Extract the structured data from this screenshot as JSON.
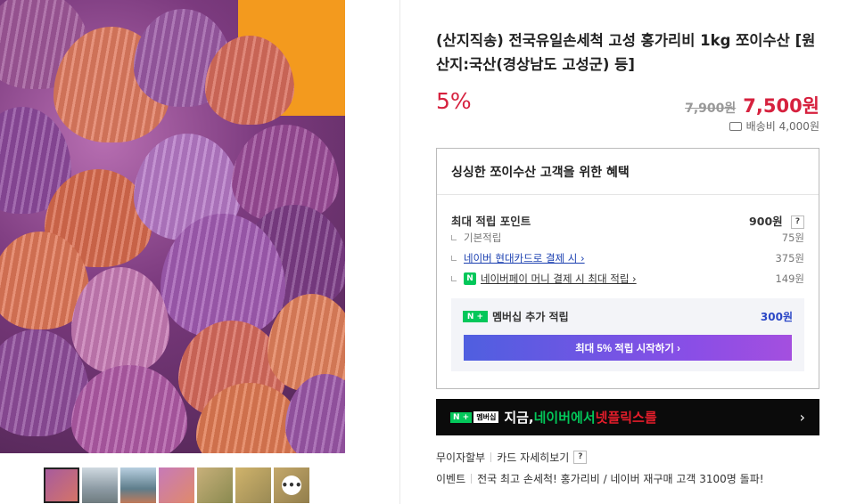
{
  "product": {
    "title": "(산지직송) 전국유일손세척 고성 홍가리비 1kg 쪼이수산 [원산지:국산(경상남도 고성군) 등]",
    "discount": "5%",
    "original_price": "7,900원",
    "sale_price": "7,500원",
    "shipping": "배송비 4,000원"
  },
  "benefit": {
    "heading": "싱싱한 쪼이수산 고객을 위한 혜택",
    "max_points_label": "최대 적립 포인트",
    "max_points_value": "900원",
    "help": "?",
    "items": [
      {
        "label": "기본적립",
        "value": "75원"
      },
      {
        "label": "네이버 현대카드로 결제 시 ›",
        "value": "375원"
      },
      {
        "label": "네이버페이 머니 결제 시 최대 적립 ›",
        "value": "149원"
      }
    ],
    "npay_badge": "N",
    "membership_badge": "N +",
    "membership_label": "멤버십 추가 적립",
    "membership_value": "300원",
    "membership_button": "최대 5% 적립 시작하기 ›"
  },
  "banner": {
    "logo_green": "N +",
    "logo_white": "멤버십",
    "text_white": "지금, ",
    "text_green": "네이버에서 ",
    "text_red": "넷플릭스를",
    "arrow": "›"
  },
  "footer": {
    "installment": "무이자할부",
    "card_detail": "카드 자세히보기",
    "help": "?",
    "event_label": "이벤트",
    "event_text": "전국 최고 손세척! 홍가리비 / 네이버 재구매 고객 3100명 돌파!"
  },
  "gallery": {
    "more_icon": "•••"
  },
  "colors": {
    "accent_red": "#d6213e",
    "naver_green": "#03c75a",
    "link_blue": "#1a3fb0"
  }
}
